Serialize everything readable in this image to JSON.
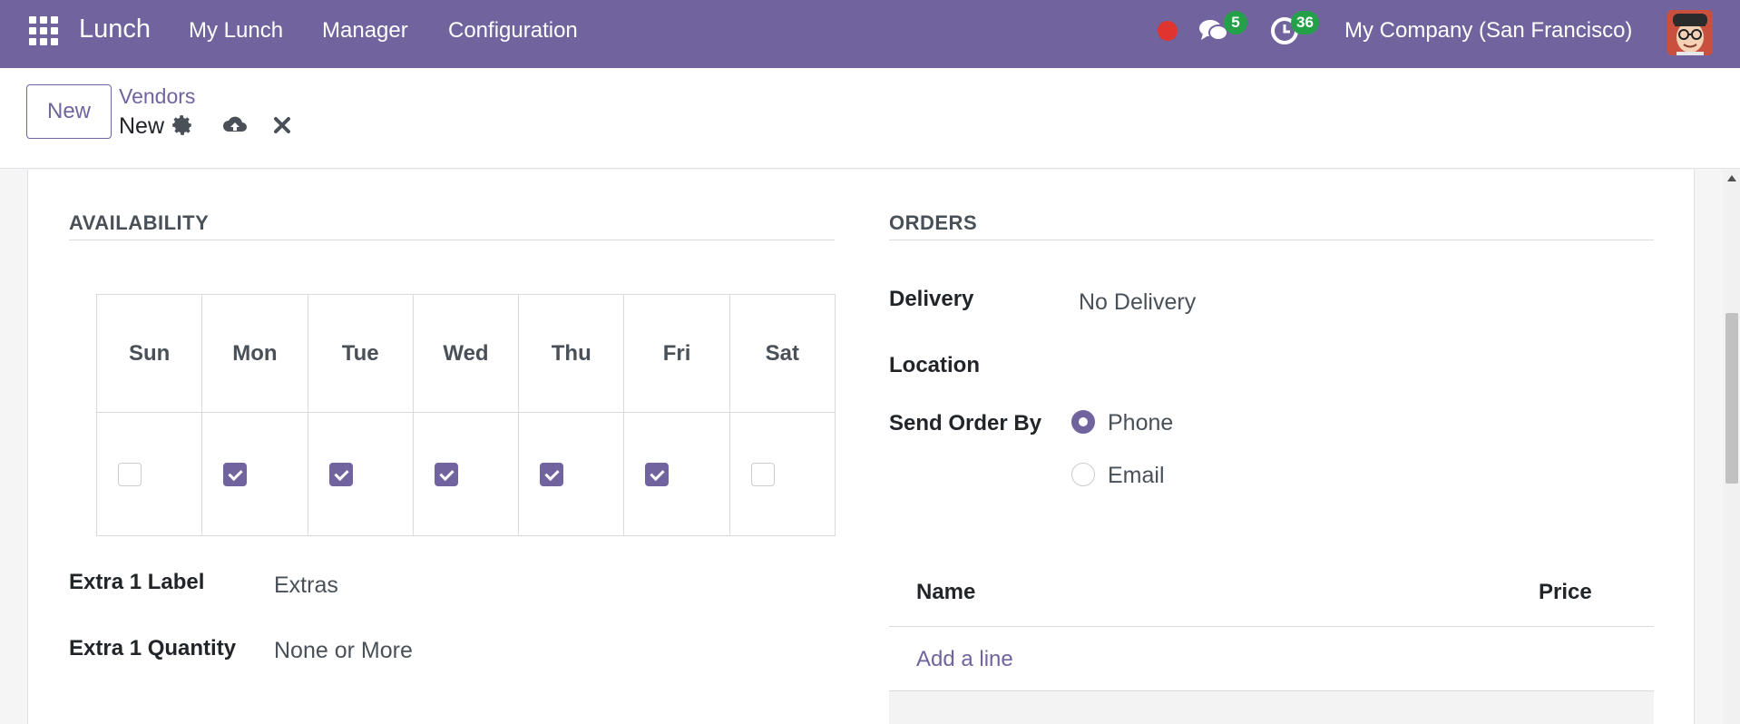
{
  "navbar": {
    "brand": "Lunch",
    "menus": [
      "My Lunch",
      "Manager",
      "Configuration"
    ],
    "messages_count": "5",
    "activities_count": "36",
    "company": "My Company (San Francisco)"
  },
  "control": {
    "new_button": "New",
    "breadcrumb_parent": "Vendors",
    "breadcrumb_current": "New"
  },
  "availability": {
    "title": "AVAILABILITY",
    "days": [
      "Sun",
      "Mon",
      "Tue",
      "Wed",
      "Thu",
      "Fri",
      "Sat"
    ],
    "checked": [
      false,
      true,
      true,
      true,
      true,
      true,
      false
    ],
    "extra1_label_label": "Extra 1 Label",
    "extra1_label_value": "Extras",
    "extra1_qty_label": "Extra 1 Quantity",
    "extra1_qty_value": "None or More"
  },
  "orders": {
    "title": "ORDERS",
    "delivery_label": "Delivery",
    "delivery_value": "No Delivery",
    "location_label": "Location",
    "send_label": "Send Order By",
    "send_options": [
      "Phone",
      "Email"
    ],
    "send_selected": "Phone",
    "table_headers": [
      "Name",
      "Price"
    ],
    "add_line": "Add a line"
  },
  "colors": {
    "brand": "#71639e",
    "badge": "#24a148",
    "record": "#e0342f"
  }
}
